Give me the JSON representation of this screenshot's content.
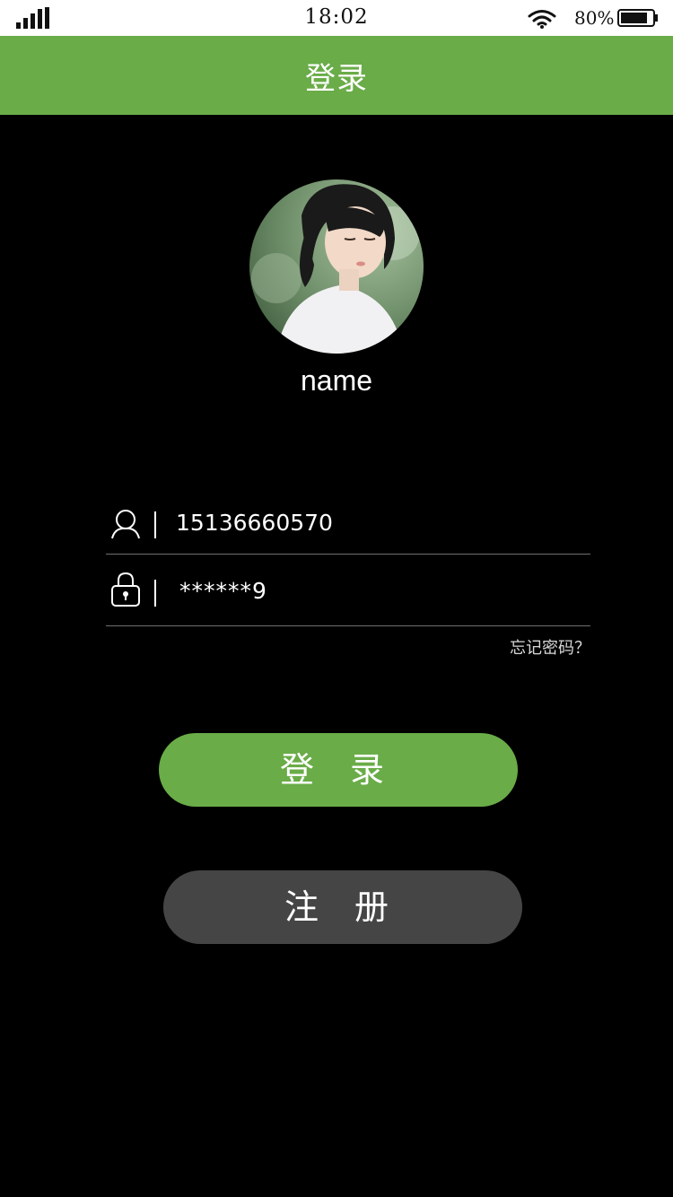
{
  "status_bar": {
    "time": "18:02",
    "battery_percent": "80%",
    "battery_level": 0.8,
    "icons": [
      "signal-icon",
      "wifi-icon",
      "battery-icon"
    ]
  },
  "nav": {
    "title": "登录"
  },
  "profile": {
    "name": "name"
  },
  "form": {
    "username_value": "15136660570",
    "password_value": "******9",
    "forgot_password": "忘记密码？",
    "username_icon": "user-icon",
    "password_icon": "lock-icon"
  },
  "buttons": {
    "login": "登 录",
    "register": "注 册"
  },
  "colors": {
    "accent": "#6aac48",
    "background": "#000000",
    "secondary_button": "#454545"
  }
}
